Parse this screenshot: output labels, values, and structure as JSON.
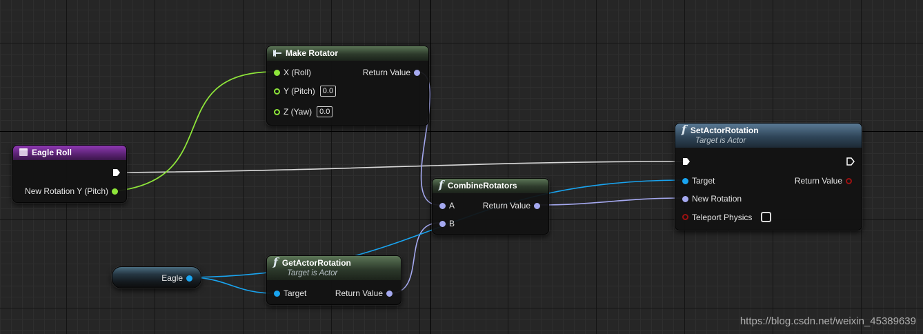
{
  "nodes": {
    "make_rotator": {
      "title": "Make Rotator",
      "inputs": [
        {
          "label": "X (Roll)"
        },
        {
          "label": "Y (Pitch)",
          "value": "0.0"
        },
        {
          "label": "Z (Yaw)",
          "value": "0.0"
        }
      ],
      "output": "Return Value"
    },
    "eagle_roll": {
      "title": "Eagle Roll",
      "output": "New Rotation Y (Pitch)"
    },
    "combine_rotators": {
      "title": "CombineRotators",
      "inputs": [
        "A",
        "B"
      ],
      "output": "Return Value"
    },
    "get_actor_rotation": {
      "title": "GetActorRotation",
      "subtitle": "Target is Actor",
      "input": "Target",
      "output": "Return Value"
    },
    "set_actor_rotation": {
      "title": "SetActorRotation",
      "subtitle": "Target is Actor",
      "inputs": [
        "Target",
        "New Rotation",
        "Teleport Physics"
      ],
      "output": "Return Value"
    },
    "eagle_var": {
      "label": "Eagle"
    }
  },
  "colors": {
    "float_pin": "#8ee53a",
    "object_pin": "#19a4f0",
    "rotator_pin": "#a5a9f0",
    "bool_pin": "#9c1111",
    "exec_wire": "#d9d9d9"
  },
  "icons": {
    "function": "function-f-icon",
    "make_struct": "make-struct-icon",
    "event": "event-icon"
  },
  "watermark": "https://blog.csdn.net/weixin_45389639"
}
